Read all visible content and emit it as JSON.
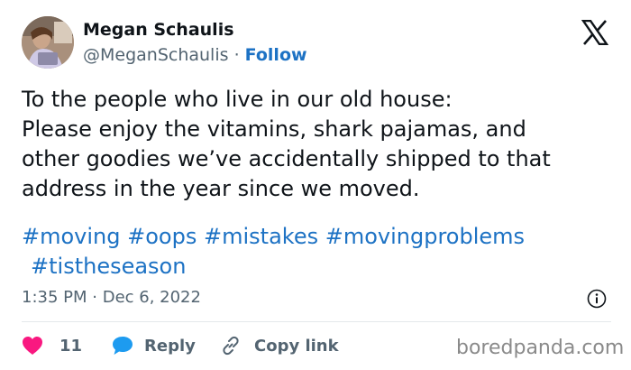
{
  "author": {
    "name": "Megan Schaulis",
    "handle": "@MeganSchaulis",
    "separator": " · ",
    "follow_label": "Follow"
  },
  "tweet": {
    "lines": [
      "To the people who live in our old house:",
      "Please enjoy the vitamins, shark pajamas, and",
      "other goodies we’ve accidentally shipped to that",
      "address in the year since we moved."
    ],
    "hashtags": [
      "#moving",
      "#oops",
      "#mistakes",
      "#movingproblems",
      "#tistheseason"
    ]
  },
  "meta": {
    "time": "1:35 PM",
    "separator": " · ",
    "date": "Dec 6, 2022"
  },
  "actions": {
    "like_count": "11",
    "reply_label": "Reply",
    "copy_link_label": "Copy link"
  },
  "watermark": "boredpanda.com",
  "colors": {
    "link": "#1d72c4",
    "like": "#f91880",
    "reply": "#1d9bf0",
    "muted": "#536471",
    "text": "#0f1419"
  },
  "icons": [
    "x-logo-icon",
    "info-icon",
    "heart-icon",
    "reply-bubble-icon",
    "link-icon"
  ]
}
